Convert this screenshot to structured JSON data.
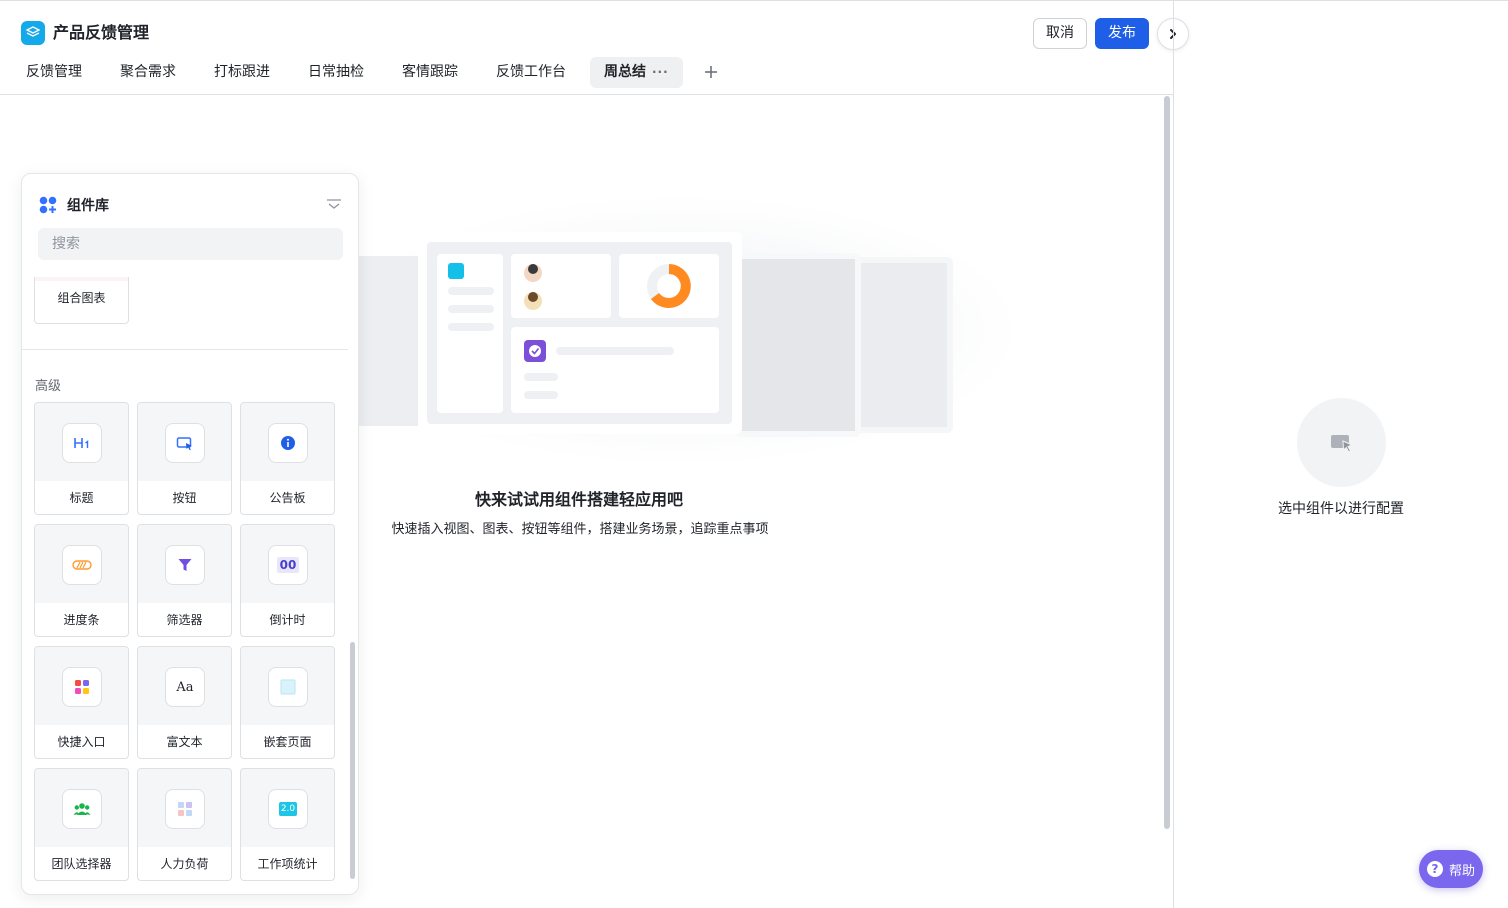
{
  "app": {
    "title": "产品反馈管理"
  },
  "header": {
    "cancel_label": "取消",
    "publish_label": "发布"
  },
  "tabs": [
    {
      "label": "反馈管理"
    },
    {
      "label": "聚合需求"
    },
    {
      "label": "打标跟进"
    },
    {
      "label": "日常抽检"
    },
    {
      "label": "客情跟踪"
    },
    {
      "label": "反馈工作台"
    },
    {
      "label": "周总结",
      "active": true,
      "more": "···"
    }
  ],
  "empty_state": {
    "title": "快来试试用组件搭建轻应用吧",
    "description": "快速插入视图、图表、按钮等组件，搭建业务场景，追踪重点事项"
  },
  "config_panel": {
    "hint": "选中组件以进行配置"
  },
  "help": {
    "label": "帮助"
  },
  "library": {
    "title": "组件库",
    "search_placeholder": "搜索",
    "partial_card": {
      "label": "组合图表"
    },
    "section_label": "高级",
    "components": [
      {
        "label": "标题",
        "icon": "heading-icon"
      },
      {
        "label": "按钮",
        "icon": "button-icon"
      },
      {
        "label": "公告板",
        "icon": "info-icon"
      },
      {
        "label": "进度条",
        "icon": "progress-icon"
      },
      {
        "label": "筛选器",
        "icon": "filter-icon"
      },
      {
        "label": "倒计时",
        "icon": "countdown-icon",
        "icon_text": "00"
      },
      {
        "label": "快捷入口",
        "icon": "shortcut-icon"
      },
      {
        "label": "富文本",
        "icon": "richtext-icon",
        "icon_text": "Aa"
      },
      {
        "label": "嵌套页面",
        "icon": "nested-page-icon"
      },
      {
        "label": "团队选择器",
        "icon": "team-icon"
      },
      {
        "label": "人力负荷",
        "icon": "workload-icon"
      },
      {
        "label": "工作项统计",
        "icon": "stats-icon",
        "icon_text": "2.0"
      }
    ]
  },
  "colors": {
    "accent": "#1f5fe8",
    "help": "#7b67ee",
    "logo": "#14a9e8"
  }
}
